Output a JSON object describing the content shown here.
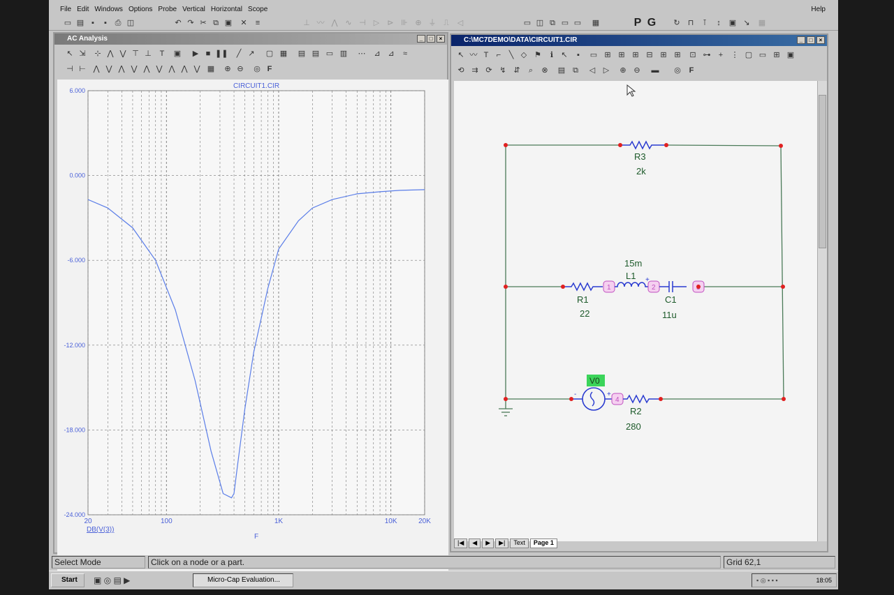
{
  "menu": {
    "items": [
      "File",
      "Edit",
      "Windows",
      "Options",
      "Probe",
      "Vertical",
      "Horizontal",
      "Scope"
    ],
    "help": "Help"
  },
  "main_toolbar": {
    "p_label": "P",
    "g_label": "G"
  },
  "analysis_window": {
    "title": "AC Analysis",
    "tool_f": "F"
  },
  "schematic_window": {
    "title": "C:\\MC7DEMO\\DATA\\CIRCUIT1.CIR",
    "tool_f": "F",
    "tabs": [
      "Text",
      "Page 1"
    ]
  },
  "chart_data": {
    "type": "line",
    "title": "CIRCUIT1.CIR",
    "xlabel": "F",
    "ylabel": "DB(V(3))",
    "x_scale": "log",
    "xlim": [
      20,
      20000
    ],
    "ylim": [
      -24,
      6
    ],
    "x_tick_labels": [
      "20",
      "100",
      "1K",
      "10K",
      "20K"
    ],
    "x_ticks": [
      20,
      100,
      1000,
      10000,
      20000
    ],
    "y_tick_labels": [
      "6.000",
      "0.000",
      "-6.000",
      "-12.000",
      "-18.000",
      "-24.000"
    ],
    "y_ticks": [
      6,
      0,
      -6,
      -12,
      -18,
      -24
    ],
    "grid": true,
    "series": [
      {
        "color": "#5a7de8",
        "x": [
          20,
          30,
          50,
          80,
          120,
          180,
          250,
          320,
          380,
          400,
          430,
          500,
          600,
          800,
          1000,
          1500,
          2000,
          3000,
          5000,
          8000,
          12000,
          20000
        ],
        "y": [
          -1.7,
          -2.3,
          -3.7,
          -6.0,
          -9.5,
          -14.5,
          -19.5,
          -22.5,
          -22.8,
          -22.5,
          -20.5,
          -16.5,
          -12.5,
          -8.0,
          -5.2,
          -3.2,
          -2.3,
          -1.7,
          -1.3,
          -1.15,
          -1.05,
          -1.0
        ]
      }
    ]
  },
  "schematic": {
    "components": [
      {
        "ref": "R3",
        "value": "2k"
      },
      {
        "ref": "L1",
        "value": "15m"
      },
      {
        "ref": "R1",
        "value": "22"
      },
      {
        "ref": "C1",
        "value": "11u"
      },
      {
        "ref": "V0",
        "value": ""
      },
      {
        "ref": "R2",
        "value": "280"
      }
    ],
    "nodes": [
      "1",
      "2",
      "3",
      "4"
    ],
    "sign_plus": "+",
    "sign_minus": "-"
  },
  "status": {
    "mode": "Select Mode",
    "hint": "Click on a node or a part.",
    "grid": "Grid 62,1"
  },
  "taskbar": {
    "start": "Start",
    "task": "Micro-Cap Evaluation...",
    "clock": "18:05"
  }
}
